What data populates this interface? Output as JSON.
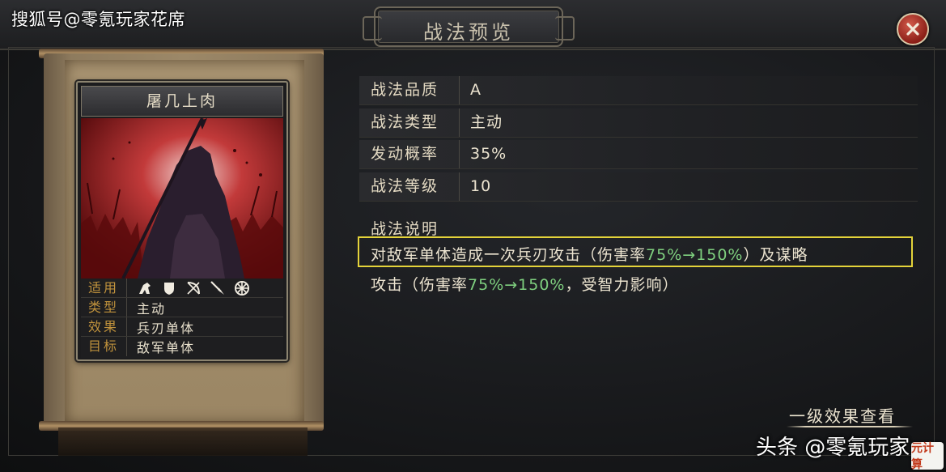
{
  "watermark_top": "搜狐号@零氪玩家花席",
  "window": {
    "title": "战法预览"
  },
  "card": {
    "name": "屠几上肉",
    "info": [
      {
        "key": "适用",
        "icons": [
          "cavalry-icon",
          "shield-icon",
          "archer-icon",
          "spear-icon",
          "wheel-icon"
        ]
      },
      {
        "key": "类型",
        "value": "主动"
      },
      {
        "key": "效果",
        "value": "兵刃单体"
      },
      {
        "key": "目标",
        "value": "敌军单体"
      }
    ]
  },
  "attributes": [
    {
      "label": "战法品质",
      "value": "A"
    },
    {
      "label": "战法类型",
      "value": "主动"
    },
    {
      "label": "发动概率",
      "value": "35%"
    },
    {
      "label": "战法等级",
      "value": "10"
    }
  ],
  "description": {
    "title": "战法说明",
    "line1_a": "对敌军单体造成一次兵刃攻击（伤害率",
    "line1_b": "75%→150%",
    "line1_c": "）及谋略",
    "line2_a": "攻击（伤害率",
    "line2_b": "75%→150%",
    "line2_c": "，受智力影响）"
  },
  "effect_link": "一级效果查看",
  "watermark_bottom": "头条 @零氪玩家",
  "logo_text": "元计算",
  "colors": {
    "accent_gold": "#c0923c",
    "highlight_box": "#e4d33a",
    "value_green": "#7fd07f",
    "close_red": "#8b1f17"
  }
}
